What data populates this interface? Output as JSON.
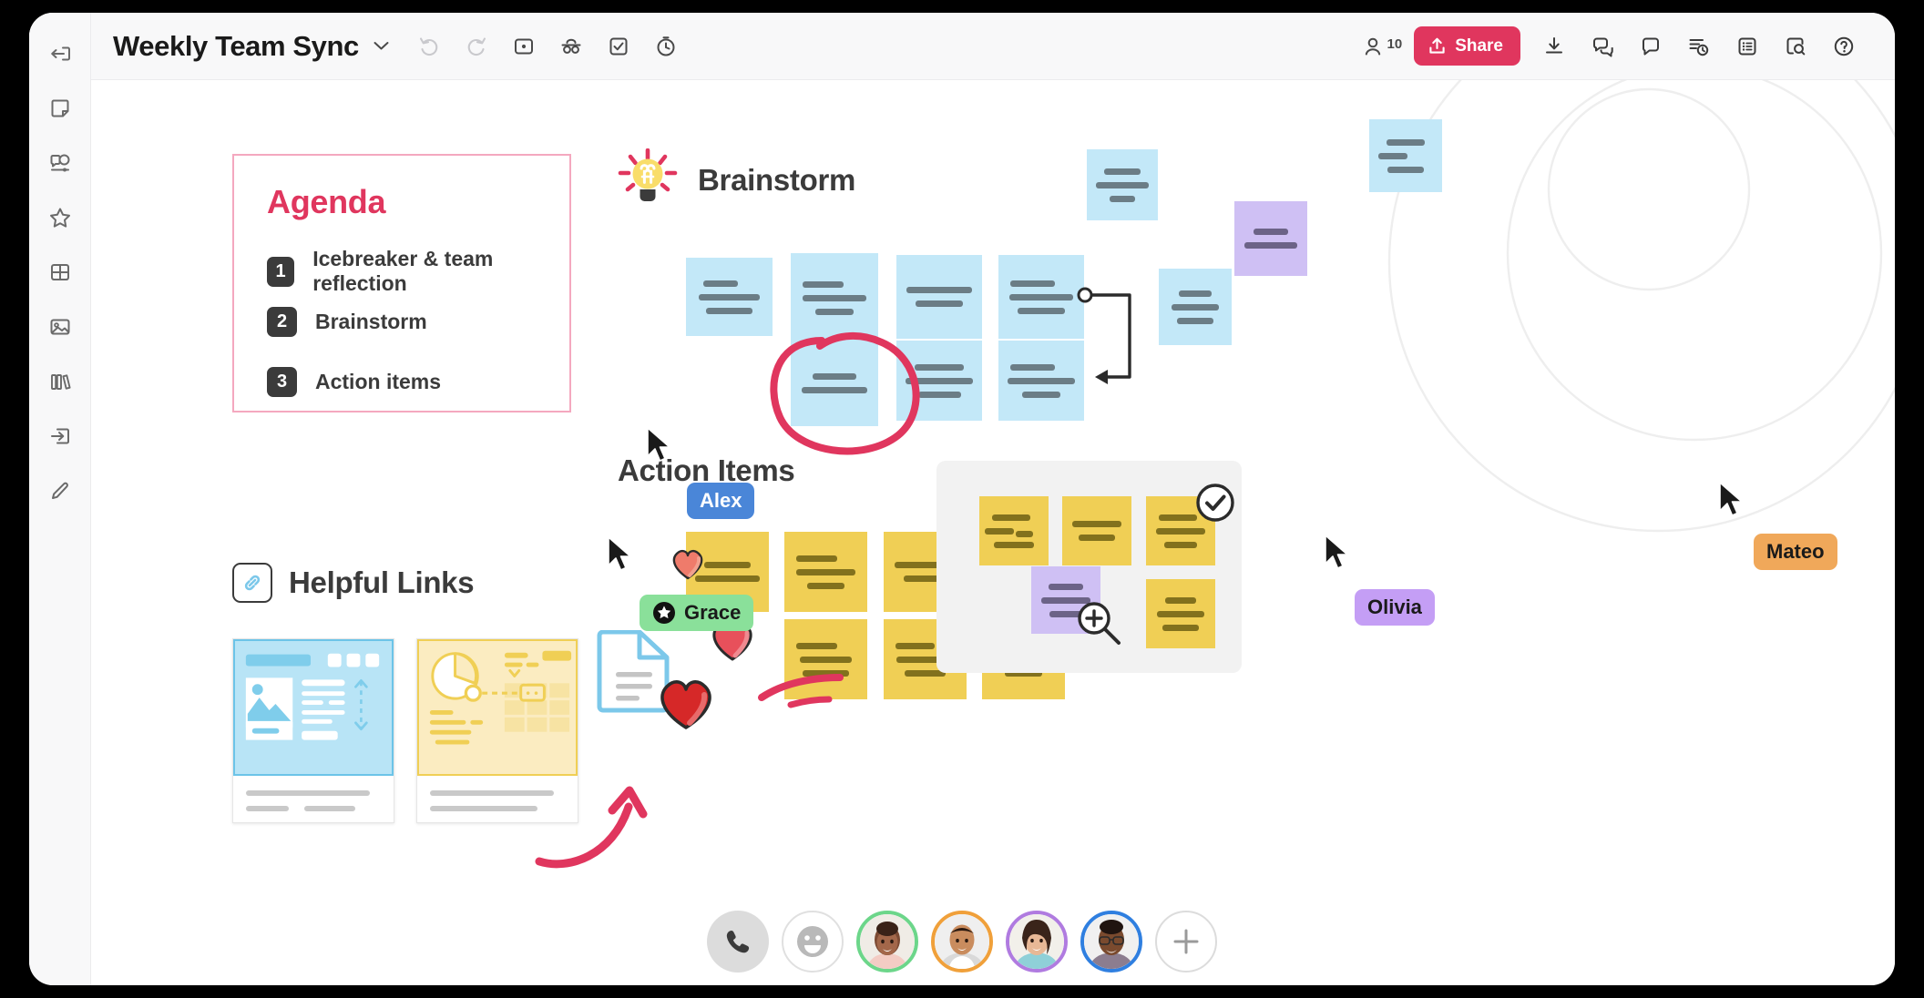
{
  "window": {
    "background": "#000000",
    "app_background": "#ffffff"
  },
  "topbar": {
    "board_title": "Weekly Team Sync",
    "title_chevron": "chevron-down-icon",
    "undo_label": "Undo",
    "redo_label": "Redo",
    "frame_label": "Frame",
    "presenter_label": "Presenter mode",
    "tasks_label": "Tasks",
    "timer_label": "Timer",
    "people_count": "10",
    "share_label": "Share",
    "right_icons": [
      {
        "name": "download-icon",
        "label": "Export"
      },
      {
        "name": "chat-icon",
        "label": "Chat"
      },
      {
        "name": "comment-icon",
        "label": "Comment"
      },
      {
        "name": "activity-icon",
        "label": "Activity"
      },
      {
        "name": "list-icon",
        "label": "Board list"
      },
      {
        "name": "find-icon",
        "label": "Find on board"
      },
      {
        "name": "help-icon",
        "label": "Help"
      }
    ]
  },
  "sidebar": {
    "items": [
      {
        "name": "collapse-icon",
        "label": "Collapse panel"
      },
      {
        "name": "sticky-note-icon",
        "label": "Sticky note"
      },
      {
        "name": "shape-comment-icon",
        "label": "Shapes"
      },
      {
        "name": "star-icon",
        "label": "Favorites"
      },
      {
        "name": "grid-icon",
        "label": "Table"
      },
      {
        "name": "image-icon",
        "label": "Images"
      },
      {
        "name": "library-icon",
        "label": "Templates"
      },
      {
        "name": "import-icon",
        "label": "Upload"
      },
      {
        "name": "pencil-icon",
        "label": "Pen"
      }
    ]
  },
  "canvas": {
    "agenda": {
      "title": "Agenda",
      "border_color": "#f4a8bf",
      "title_color": "#e0365e",
      "items": [
        {
          "number": "1",
          "text": "Icebreaker & team reflection"
        },
        {
          "number": "2",
          "text": "Brainstorm"
        },
        {
          "number": "3",
          "text": "Action items"
        }
      ]
    },
    "helpful_links": {
      "title": "Helpful Links",
      "icon": "link-chain-icon",
      "cards": [
        {
          "name": "link-preview-webpage",
          "theme": "#8ed3ef"
        },
        {
          "name": "link-preview-chart",
          "theme": "#f0cf55"
        }
      ],
      "document_icon": "document-icon"
    },
    "brainstorm": {
      "title": "Brainstorm",
      "icon": "lightbulb-icon",
      "bulb_color": "#f9dd6a",
      "ray_color": "#e0365e",
      "notes_color": "#c3e8f8",
      "note_count": 7,
      "annotation": "circle-highlight",
      "annotation_color": "#e0365e",
      "connector": "arrow-connector"
    },
    "action_items": {
      "title": "Action Items",
      "notes_color": "#f0cf55",
      "note_count": 7,
      "reactions": [
        {
          "name": "heart-reaction-small",
          "color": "#ef7b6b"
        },
        {
          "name": "heart-reaction-medium",
          "color": "#e8505b"
        },
        {
          "name": "heart-reaction-large",
          "color": "#d62828"
        },
        {
          "name": "thumbs-up-reaction",
          "color": "#64c8e8"
        }
      ],
      "underline_color": "#e0365e"
    },
    "group_frame": {
      "background": "#f2f2f2",
      "check_badge": "check-circle-icon",
      "zoom_badge": "zoom-in-icon",
      "note_colors": {
        "yellow": "#f0cf55",
        "purple": "#cfc0f4"
      }
    },
    "cluster": {
      "rings": "concentric-circles",
      "note_colors": {
        "blue": "#c3e8f8",
        "purple": "#cfc0f4"
      }
    },
    "collaborators": [
      {
        "name": "Alex",
        "color": "#4a86d8",
        "text_color": "#ffffff",
        "badge": null
      },
      {
        "name": "Grace",
        "color": "#8ae09a",
        "text_color": "#1a1a1a",
        "badge": "star-badge"
      },
      {
        "name": "Olivia",
        "color": "#c49ef5",
        "text_color": "#1a1a1a",
        "badge": null
      },
      {
        "name": "Mateo",
        "color": "#f0a85a",
        "text_color": "#1a1a1a",
        "badge": null
      }
    ]
  },
  "bottombar": {
    "call_button": "phone-icon",
    "reaction_button": "smiley-icon",
    "add_button": "plus-icon",
    "participants": [
      {
        "name": "participant-1",
        "ring": "#6cd68a"
      },
      {
        "name": "participant-2",
        "ring": "#f0a03a"
      },
      {
        "name": "participant-3",
        "ring": "#b07be0"
      },
      {
        "name": "participant-4",
        "ring": "#2f7fe0"
      }
    ]
  }
}
